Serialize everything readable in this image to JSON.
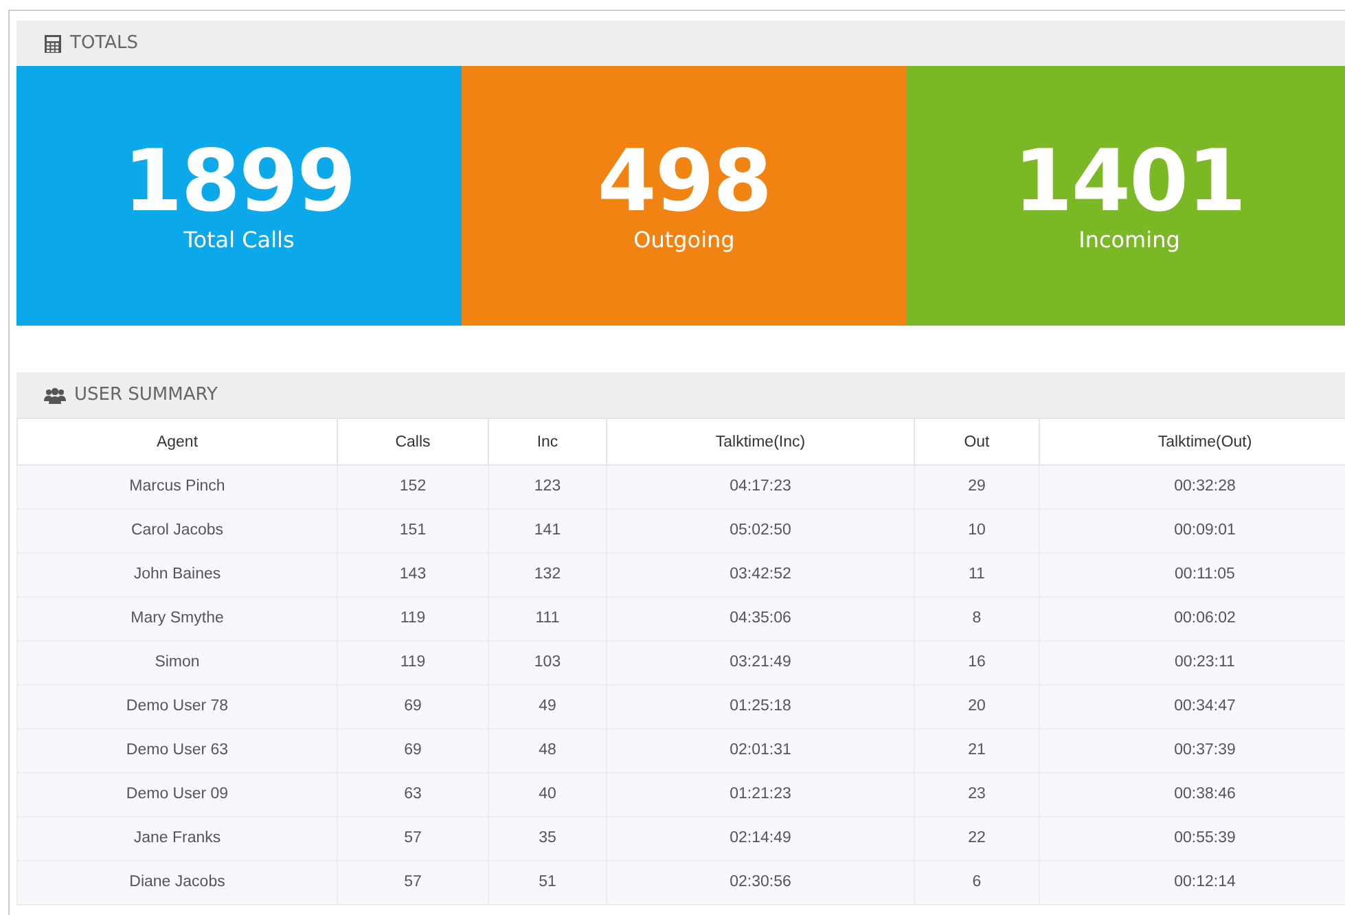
{
  "totals": {
    "title": "TOTALS",
    "tiles": [
      {
        "kind": "total",
        "value": "1899",
        "label": "Total Calls"
      },
      {
        "kind": "outgoing",
        "value": "498",
        "label": "Outgoing"
      },
      {
        "kind": "incoming",
        "value": "1401",
        "label": "Incoming"
      }
    ]
  },
  "user_summary": {
    "title": "USER SUMMARY",
    "table": {
      "columns": [
        "Agent",
        "Calls",
        "Inc",
        "Talktime(Inc)",
        "Out",
        "Talktime(Out)"
      ],
      "rows": [
        [
          "Marcus Pinch",
          "152",
          "123",
          "04:17:23",
          "29",
          "00:32:28"
        ],
        [
          "Carol Jacobs",
          "151",
          "141",
          "05:02:50",
          "10",
          "00:09:01"
        ],
        [
          "John Baines",
          "143",
          "132",
          "03:42:52",
          "11",
          "00:11:05"
        ],
        [
          "Mary Smythe",
          "119",
          "111",
          "04:35:06",
          "8",
          "00:06:02"
        ],
        [
          "Simon",
          "119",
          "103",
          "03:21:49",
          "16",
          "00:23:11"
        ],
        [
          "Demo User 78",
          "69",
          "49",
          "01:25:18",
          "20",
          "00:34:47"
        ],
        [
          "Demo User 63",
          "69",
          "48",
          "02:01:31",
          "21",
          "00:37:39"
        ],
        [
          "Demo User 09",
          "63",
          "40",
          "01:21:23",
          "23",
          "00:38:46"
        ],
        [
          "Jane Franks",
          "57",
          "35",
          "02:14:49",
          "22",
          "00:55:39"
        ],
        [
          "Diane Jacobs",
          "57",
          "51",
          "02:30:56",
          "6",
          "00:12:14"
        ]
      ]
    }
  }
}
